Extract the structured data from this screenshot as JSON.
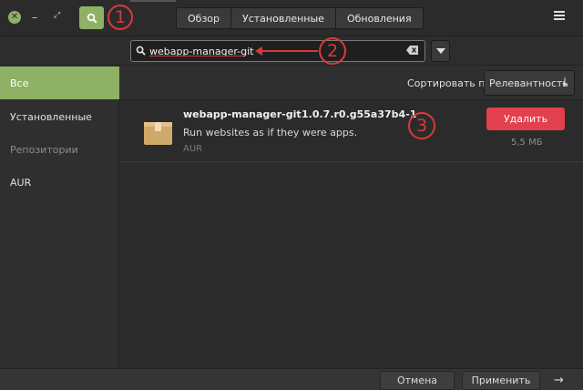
{
  "header": {
    "tabs": [
      {
        "label": "Обзор"
      },
      {
        "label": "Установленные"
      },
      {
        "label": "Обновления"
      }
    ],
    "annotation_1": "1"
  },
  "search": {
    "value": "webapp-manager-git",
    "annotation_2": "2"
  },
  "sidebar": {
    "items": [
      {
        "label": "Все",
        "active": true
      },
      {
        "label": "Установленные"
      },
      {
        "label": "Репозитории",
        "muted": true
      },
      {
        "label": "AUR"
      }
    ]
  },
  "sort": {
    "label": "Сортировать по",
    "selected": "Релевантность"
  },
  "results": [
    {
      "name": "webapp-manager-git",
      "version": "1.0.7.r0.g55a37b4-1",
      "description": "Run websites as if they were apps.",
      "source": "AUR",
      "action_label": "Удалить",
      "size": "5,5 МБ",
      "annotation_3": "3"
    }
  ],
  "footer": {
    "cancel_label": "Отмена",
    "apply_label": "Применить"
  },
  "colors": {
    "accent": "#8fb166",
    "danger": "#e2404e",
    "annotation": "#d83a3a"
  }
}
